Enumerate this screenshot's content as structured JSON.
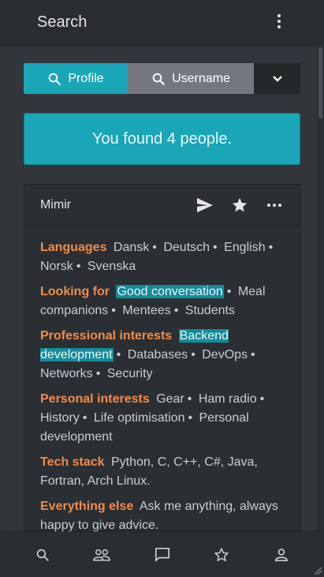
{
  "appbar": {
    "title": "Search",
    "menu_icon": "more-vert-icon"
  },
  "search_mode": {
    "profile_label": "Profile",
    "username_label": "Username",
    "active": "Profile",
    "dropdown_icon": "chevron-down-icon"
  },
  "results": {
    "summary": "You found 4 people."
  },
  "card": {
    "name": "Mimir",
    "actions": [
      "send-icon",
      "star-icon",
      "more-horiz-icon"
    ],
    "sections": {
      "languages": {
        "label": "Languages",
        "items": [
          "Dansk",
          "Deutsch",
          "English",
          "Norsk",
          "Svenska"
        ]
      },
      "looking_for": {
        "label": "Looking for",
        "items": [
          "Good conversation",
          "Meal companions",
          "Mentees",
          "Students"
        ]
      },
      "professional": {
        "label": "Professional interests",
        "items": [
          "Backend development",
          "Databases",
          "DevOps",
          "Networks",
          "Security"
        ]
      },
      "personal": {
        "label": "Personal interests",
        "items": [
          "Gear",
          "Ham radio",
          "History",
          "Life optimisation",
          "Personal development"
        ]
      },
      "tech_stack": {
        "label": "Tech stack",
        "text": "Python, C, C++, C#, Java, Fortran, Arch Linux."
      },
      "everything_else": {
        "label": "Everything else",
        "text": "Ask me anything, always happy to give advice."
      }
    }
  },
  "bottom_nav": [
    "search-icon",
    "people-icon",
    "chat-icon",
    "star-icon",
    "person-icon"
  ],
  "colors": {
    "accent": "#1aa6b7",
    "label": "#f08b4a",
    "background": "#32363b"
  }
}
